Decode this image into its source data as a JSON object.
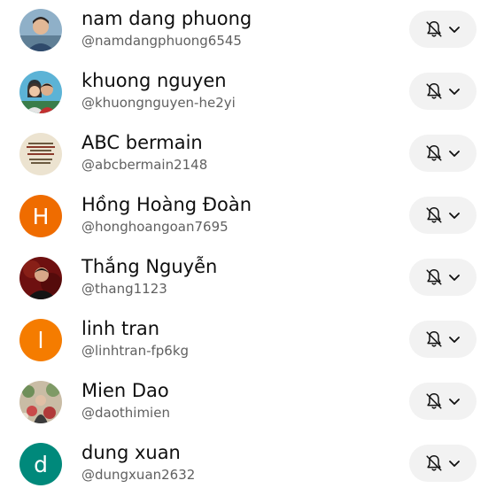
{
  "subscriptions": [
    {
      "name": "nam dang phuong",
      "handle": "@namdangphuong6545",
      "avatar": "photo",
      "avatar_color": "#6b8fa8",
      "bell_icon": "bell-off-icon",
      "menu_icon": "chevron-down-icon"
    },
    {
      "name": "khuong nguyen",
      "handle": "@khuongnguyen-he2yi",
      "avatar": "photo",
      "avatar_color": "#4aa3c9",
      "bell_icon": "bell-off-icon",
      "menu_icon": "chevron-down-icon"
    },
    {
      "name": "ABC bermain",
      "handle": "@abcbermain2148",
      "avatar": "photo",
      "avatar_color": "#e8ddc8",
      "bell_icon": "bell-off-icon",
      "menu_icon": "chevron-down-icon"
    },
    {
      "name": "Hồng Hoàng Đoàn",
      "handle": "@honghoangoan7695",
      "avatar": "initial",
      "initial": "H",
      "avatar_color": "#ef6c00",
      "bell_icon": "bell-off-icon",
      "menu_icon": "chevron-down-icon"
    },
    {
      "name": "Thắng Nguyễn",
      "handle": "@thang1123",
      "avatar": "photo",
      "avatar_color": "#7a1414",
      "bell_icon": "bell-off-icon",
      "menu_icon": "chevron-down-icon"
    },
    {
      "name": "linh tran",
      "handle": "@linhtran-fp6kg",
      "avatar": "initial",
      "initial": "l",
      "avatar_color": "#f57c00",
      "bell_icon": "bell-off-icon",
      "menu_icon": "chevron-down-icon"
    },
    {
      "name": "Mien Dao",
      "handle": "@daothimien",
      "avatar": "photo",
      "avatar_color": "#b9a890",
      "bell_icon": "bell-off-icon",
      "menu_icon": "chevron-down-icon"
    },
    {
      "name": "dung xuan",
      "handle": "@dungxuan2632",
      "avatar": "initial",
      "initial": "d",
      "avatar_color": "#00897b",
      "bell_icon": "bell-off-icon",
      "menu_icon": "chevron-down-icon"
    }
  ]
}
